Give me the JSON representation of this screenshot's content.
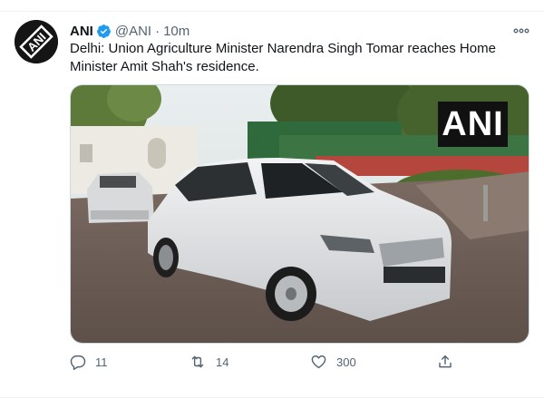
{
  "tweet": {
    "display_name": "ANI",
    "handle": "@ANI",
    "separator": "·",
    "time": "10m",
    "text": "Delhi: Union Agriculture Minister Narendra Singh Tomar reaches Home Minister Amit Shah's residence.",
    "avatar_text": "ANI",
    "media_watermark": "ANI",
    "more_icon": "more-horizontal-icon",
    "verified_icon": "verified-badge-icon"
  },
  "actions": {
    "reply": {
      "icon": "reply-icon",
      "count": "11"
    },
    "retweet": {
      "icon": "retweet-icon",
      "count": "14"
    },
    "like": {
      "icon": "heart-icon",
      "count": "300"
    },
    "share": {
      "icon": "share-icon"
    }
  },
  "colors": {
    "verified": "#1d9bf0",
    "secondary_text": "#536471",
    "primary_text": "#0f1419",
    "divider": "#eff3f4"
  }
}
